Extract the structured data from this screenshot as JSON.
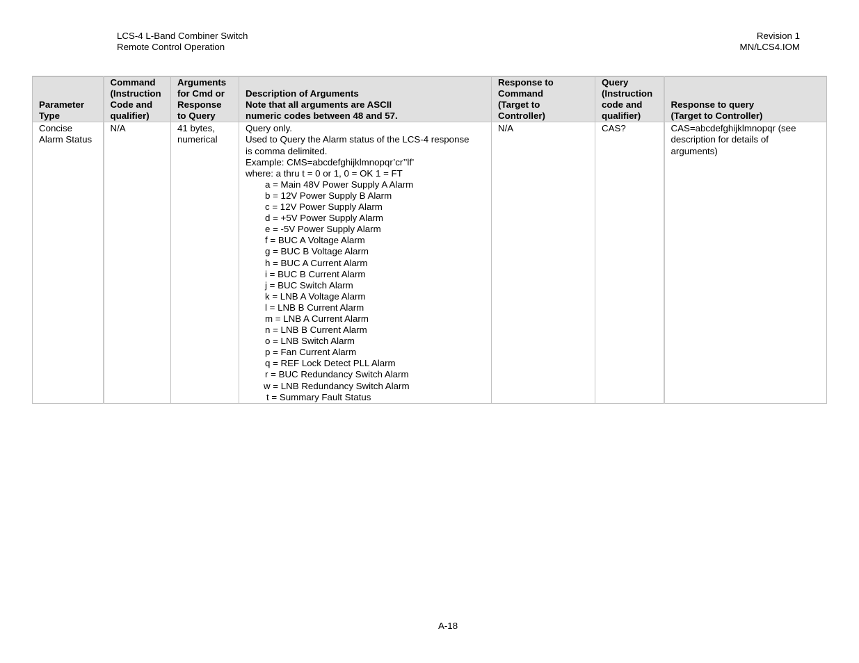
{
  "header": {
    "left_line1": "LCS-4 L-Band Combiner Switch",
    "left_line2": "Remote Control Operation",
    "right_line1": "Revision 1",
    "right_line2": "MN/LCS4.IOM"
  },
  "table": {
    "columns": [
      [
        "Parameter",
        "Type"
      ],
      [
        "Command",
        "(Instruction",
        "Code and",
        "qualifier)"
      ],
      [
        "Arguments",
        "for Cmd or",
        "Response",
        "to Query"
      ],
      [
        "Description of Arguments",
        "Note that all arguments are ASCII",
        "numeric codes between 48 and 57."
      ],
      [
        "Response to",
        "Command",
        "(Target to",
        "Controller)"
      ],
      [
        "Query",
        "(Instruction",
        "code and",
        "qualifier)"
      ],
      [
        "Response to query",
        "(Target to Controller)"
      ]
    ],
    "row": {
      "parameter_type": [
        "Concise",
        "Alarm Status"
      ],
      "command": "N/A",
      "arguments": [
        "41 bytes,",
        "numerical"
      ],
      "description_intro": [
        "Query only.",
        "Used to Query the Alarm status of the LCS-4 response",
        "is comma delimited.",
        "Example: CMS=abcdefghijklmnopqr’cr’’lf’",
        "where:  a thru t = 0 or 1, 0 = OK 1 = FT"
      ],
      "alarms": [
        "a = Main 48V Power Supply A Alarm",
        "b = 12V Power Supply B Alarm",
        "c = 12V Power Supply Alarm",
        "d = +5V Power Supply Alarm",
        "e = -5V Power Supply Alarm",
        "f = BUC A Voltage Alarm",
        "g = BUC B Voltage Alarm",
        "h = BUC A Current Alarm",
        "i = BUC B Current Alarm",
        "j = BUC Switch Alarm",
        "k = LNB A Voltage Alarm",
        "l = LNB B Current Alarm",
        "m = LNB A Current Alarm",
        "n = LNB B Current Alarm",
        "o = LNB Switch Alarm",
        "p = Fan Current Alarm",
        "q = REF Lock Detect PLL Alarm",
        "r = BUC Redundancy Switch Alarm",
        "w = LNB Redundancy Switch Alarm",
        "t = Summary Fault Status"
      ],
      "response_to_command": "N/A",
      "query": "CAS?",
      "response_to_query": [
        "CAS=abcdefghijklmnopqr (see",
        "description for details of",
        "arguments)"
      ]
    }
  },
  "footer": {
    "page_number": "A-18"
  }
}
